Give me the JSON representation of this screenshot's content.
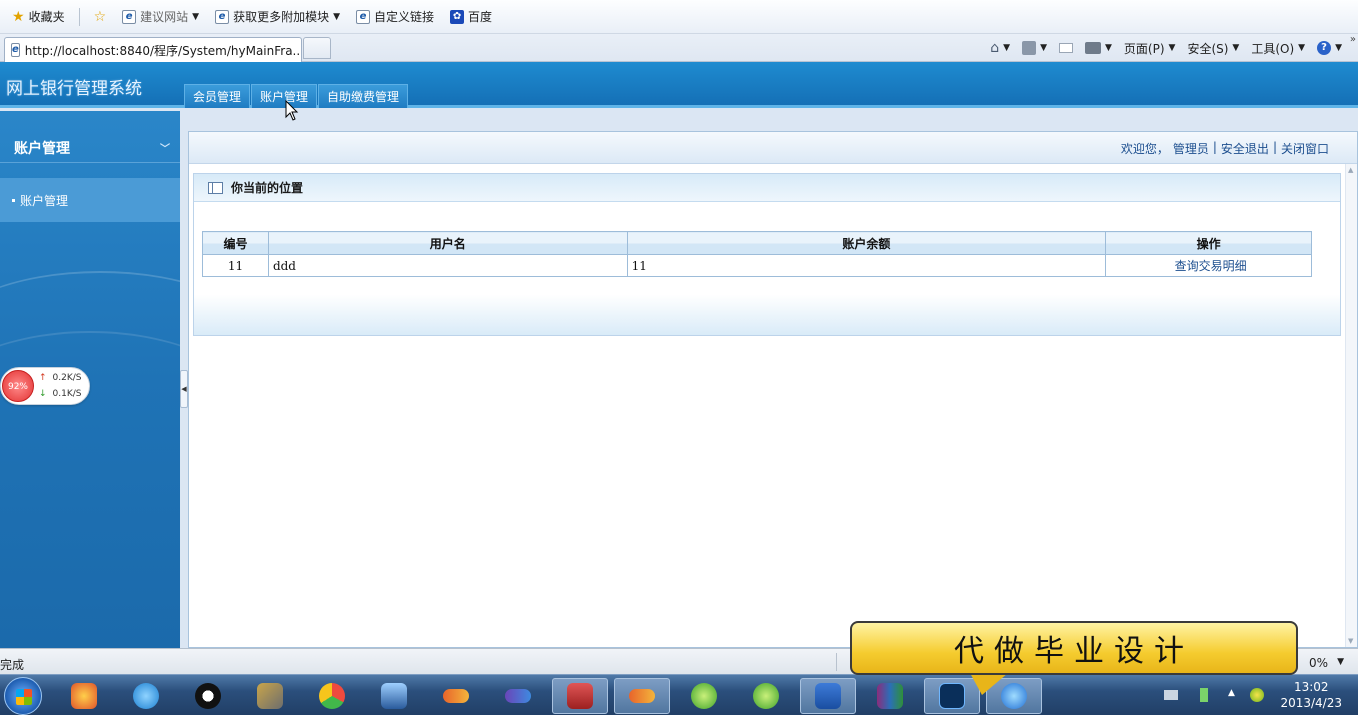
{
  "browser": {
    "favorites": [
      {
        "label": "收藏夹",
        "icon": "star-icon"
      },
      {
        "label": "建议网站",
        "icon": "ie-page-icon"
      },
      {
        "label": "获取更多附加模块",
        "icon": "ie-page-icon"
      },
      {
        "label": "自定义链接",
        "icon": "ie-page-icon"
      },
      {
        "label": "百度",
        "icon": "paw-icon"
      }
    ],
    "tab_title": "http://localhost:8840/程序/System/hyMainFra...",
    "commands": {
      "page": "页面(P)",
      "safety": "安全(S)",
      "tools": "工具(O)"
    },
    "status": "完成",
    "zoom": "0%"
  },
  "app": {
    "title": "网上银行管理系统",
    "nav_tabs": [
      "会员管理",
      "账户管理",
      "自助缴费管理"
    ]
  },
  "sidebar": {
    "heading": "账户管理",
    "items": [
      "账户管理"
    ]
  },
  "header_links": {
    "welcome": "欢迎您，",
    "user": "管理员",
    "logout": "安全退出",
    "close": "关闭窗口"
  },
  "panel": {
    "title": "你当前的位置"
  },
  "table": {
    "columns": [
      "编号",
      "用户名",
      "账户余额",
      "操作"
    ],
    "rows": [
      {
        "id": "11",
        "username": "ddd",
        "balance": "11",
        "action": "查询交易明细"
      }
    ]
  },
  "speed_widget": {
    "percent": "92%",
    "up": "0.2K/S",
    "down": "0.1K/S"
  },
  "callout": "代做毕业设计",
  "taskbar": {
    "time": "13:02",
    "date": "2013/4/23"
  },
  "colors": {
    "header_blue": "#1570b6",
    "link_blue": "#1d4f8f",
    "callout_yellow": "#f5cc2f"
  }
}
